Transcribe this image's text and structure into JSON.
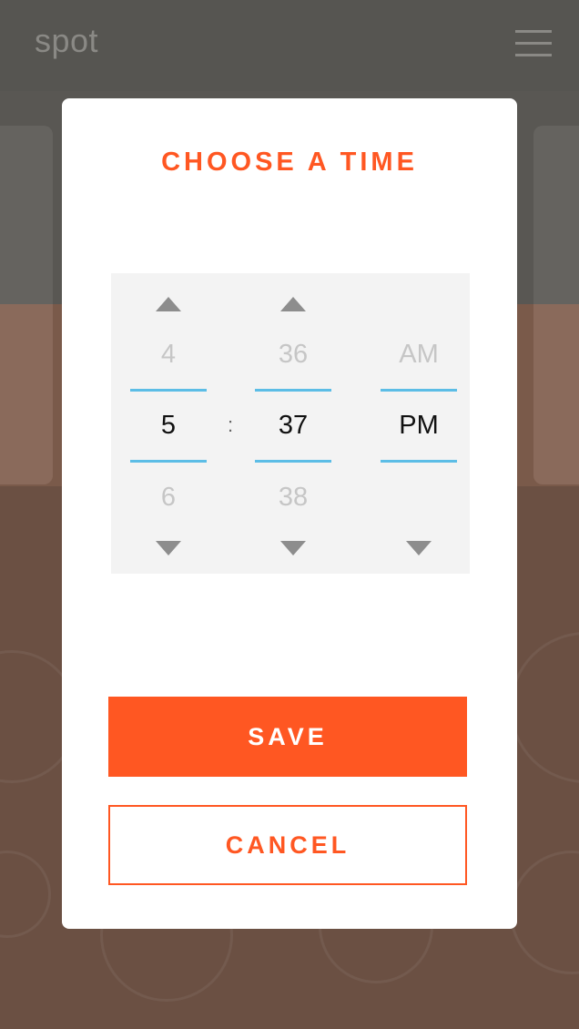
{
  "app": {
    "logo_text": "spot",
    "menu_icon": "hamburger-menu-icon"
  },
  "dialog": {
    "title": "CHOOSE A TIME",
    "time_picker": {
      "hour": {
        "prev": "4",
        "current": "5",
        "next": "6"
      },
      "separator": ":",
      "minute": {
        "prev": "36",
        "current": "37",
        "next": "38"
      },
      "period": {
        "prev": "AM",
        "current": "PM",
        "next": ""
      }
    },
    "save_label": "SAVE",
    "cancel_label": "CANCEL"
  },
  "colors": {
    "accent": "#ff5722",
    "selection_line": "#5cbde6",
    "picker_background": "#f3f3f3",
    "overlay_header": "#565551",
    "overlay_body": "#6b5043"
  }
}
